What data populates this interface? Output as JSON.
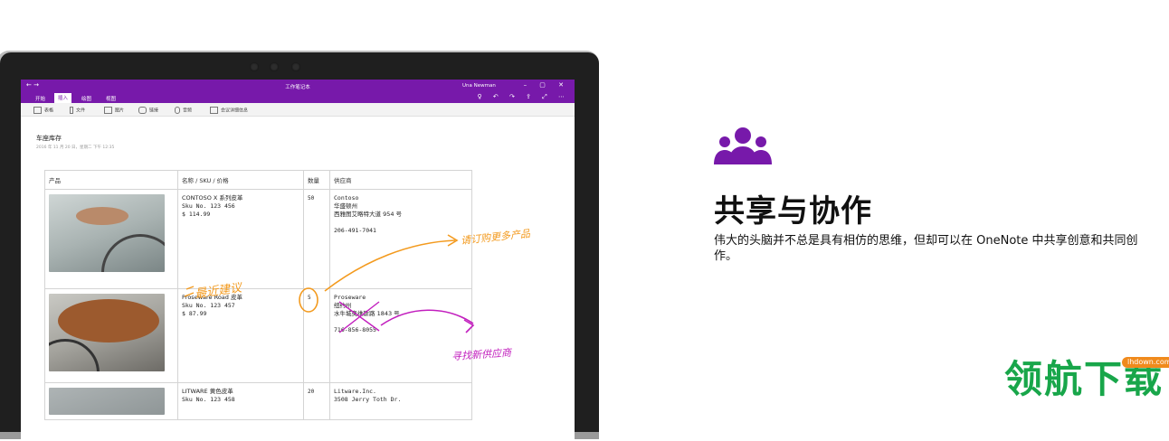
{
  "window": {
    "title": "工作笔记本",
    "user": "Una Newman",
    "nav_back": "←",
    "nav_forward": "→",
    "controls": "–  ▢  ✕",
    "ribbon_right": "♀ ↶ ↷ ⇪ ⤢ ⋯"
  },
  "tabs": [
    "开始",
    "插入",
    "绘图",
    "视图"
  ],
  "toolbar": [
    "表格",
    "文件",
    "图片",
    "链接",
    "音频",
    "会议详细信息"
  ],
  "page": {
    "title": "车座库存",
    "date": "2016 年 11 月 20 日，星期二      下午 12:35"
  },
  "table": {
    "headers": [
      "产品",
      "名称 / SKU / 价格",
      "数量",
      "供应商"
    ],
    "rows": [
      {
        "name": "CONTOSO X 系列皮革",
        "sku": "Sku No. 123 456",
        "price": "$ 114.99",
        "qty": "50",
        "supplier": "Contoso",
        "city": "华盛顿州",
        "address": "西雅图艾略特大道 954 号",
        "phone": "206-491-7041"
      },
      {
        "name": "Proseware Road 皮革",
        "sku": "Sku No. 123 457",
        "price": "$ 87.99",
        "qty": "5",
        "supplier": "Proseware",
        "city": "纽约州",
        "address": "水牛城奥维斯路 1843 号",
        "phone": "716-856-8055"
      },
      {
        "name": "LITWARE 黄色皮革",
        "sku": "Sku No. 123 458",
        "price": "",
        "qty": "20",
        "supplier": "Litware.Inc.",
        "city": "3508 Jerry Toth Dr.",
        "address": "",
        "phone": ""
      }
    ]
  },
  "ink": {
    "note_recent": "最近建议",
    "note_order": "请订购更多产品",
    "note_supplier": "寻找新供应商"
  },
  "feature": {
    "icon": "people-icon",
    "heading": "共享与协作",
    "description": "伟大的头脑并不总是具有相仿的思维，但却可以在 OneNote 中共享创意和共同创作。"
  },
  "watermark": {
    "main": "领航下载",
    "url": "lhdown.com"
  },
  "colors": {
    "accent": "#7719aa",
    "ink_orange": "#f39a1e",
    "ink_magenta": "#c21fbe",
    "watermark_green": "#18a64a",
    "watermark_orange": "#f08a1c"
  }
}
